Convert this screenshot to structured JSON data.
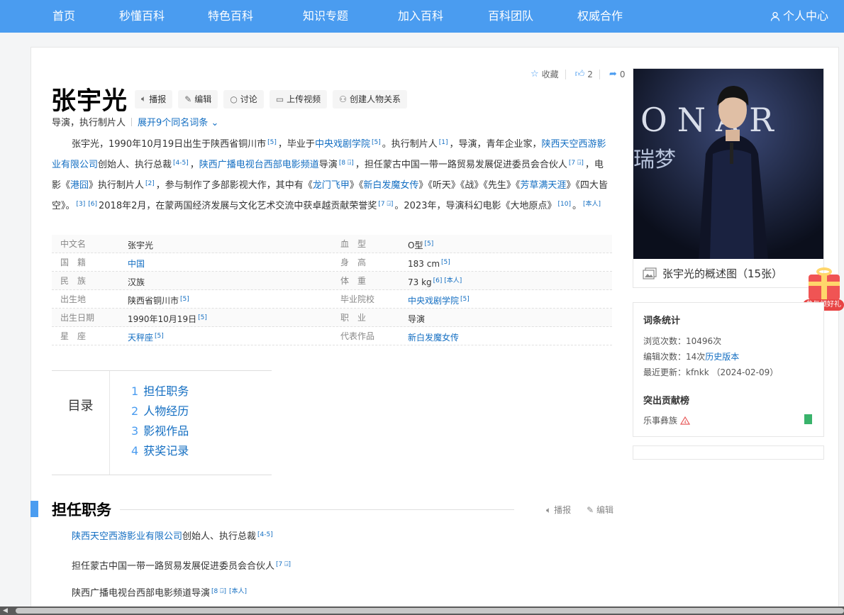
{
  "nav": {
    "items": [
      "首页",
      "秒懂百科",
      "特色百科",
      "知识专题",
      "加入百科",
      "百科团队",
      "权威合作"
    ],
    "user": "个人中心"
  },
  "entry": {
    "title": "张宇光",
    "tools": [
      "播报",
      "编辑",
      "讨论",
      "上传视频",
      "创建人物关系"
    ],
    "actions": {
      "collect": "收藏",
      "like_count": "2",
      "share_count": "0"
    },
    "desc": "导演，执行制片人",
    "expand": "展开9个同名词条"
  },
  "summary": {
    "p1": "张宇光，1990年10月19日出生于陕西省铜川市",
    "ref5": "[5]",
    "p2": "，毕业于",
    "school": "中央戏剧学院",
    "p3": "。执行制片人",
    "ref1": "[1]",
    "p4": "，导演，青年企业家，",
    "company": "陕西天空西游影业有限公司",
    "p5": "创始人、执行总裁",
    "ref45": "[4-5]",
    "p6": "，",
    "channel": "陕西广播电视台西部电影频道",
    "p7": "导演",
    "ref8": "[8 ⍈]",
    "p8": "，担任蒙古中国一带一路贸易发展促进委员会合伙人",
    "ref7": "[7 ⍈]",
    "p9": "，电影《",
    "film1": "港囧",
    "p10": "》执行制片人",
    "ref2": "[2]",
    "p11": "，参与制作了多部影视大作，其中有《",
    "film2": "龙门飞甲",
    "p12": "》《",
    "film3": "新白发魔女传",
    "p13": "》《听天》《战》《先生》《",
    "film4": "芳草满天涯",
    "p14": "》《四大皆空》。",
    "ref3": "[3]",
    "ref6": "[6]",
    "p15": "2018年2月，在蒙两国经济发展与文化艺术交流中获卓越贡献荣誉奖",
    "p16": "。2023年，导演科幻电影《大地原点》",
    "ref10": "[10]",
    "p17": "。",
    "self_tag": "[本人]"
  },
  "basic_info": [
    {
      "name": "中文名",
      "value": "张宇光",
      "ref": "",
      "link": false
    },
    {
      "name": "血　型",
      "value": "O型",
      "ref": "[5]",
      "link": false
    },
    {
      "name": "国　籍",
      "value": "中国",
      "ref": "",
      "link": true
    },
    {
      "name": "身　高",
      "value": "183 cm",
      "ref": "[5]",
      "link": false
    },
    {
      "name": "民　族",
      "value": "汉族",
      "ref": "",
      "link": false
    },
    {
      "name": "体　重",
      "value": "73 kg",
      "ref": "[6] [本人]",
      "link": false
    },
    {
      "name": "出生地",
      "value": "陕西省铜川市",
      "ref": "[5]",
      "link": false
    },
    {
      "name": "毕业院校",
      "value": "中央戏剧学院",
      "ref": "[5]",
      "link": true
    },
    {
      "name": "出生日期",
      "value": "1990年10月19日",
      "ref": "[5]",
      "link": false
    },
    {
      "name": "职　业",
      "value": "导演",
      "ref": "",
      "link": false
    },
    {
      "name": "星　座",
      "value": "天秤座",
      "ref": "[5]",
      "link": true
    },
    {
      "name": "代表作品",
      "value": "新白发魔女传",
      "ref": "",
      "link": true
    }
  ],
  "catalog": {
    "title": "目录",
    "items": [
      {
        "num": "1",
        "label": "担任职务"
      },
      {
        "num": "2",
        "label": "人物经历"
      },
      {
        "num": "3",
        "label": "影视作品"
      },
      {
        "num": "4",
        "label": "获奖记录"
      }
    ]
  },
  "section1": {
    "title": "担任职务",
    "speak": "播报",
    "edit": "编辑",
    "para1_link": "陕西天空西游影业有限公司",
    "para1_text": "创始人、执行总裁",
    "para1_ref": "[4-5]",
    "para2_text": "担任蒙古中国一带一路贸易发展促进委员会合伙人",
    "para2_ref": "[7 ⍈]",
    "para3_text": "陕西广播电视台西部电影频道导演",
    "para3_ref": "[8 ⍈]",
    "para3_tag": "[本人]"
  },
  "album": {
    "caption": "张宇光的概述图（15张）",
    "photo_text_top": "ONAR",
    "photo_text_side": "瑞梦"
  },
  "stats": {
    "title": "词条统计",
    "views": "浏览次数：10496次",
    "edits_prefix": "编辑次数：14次",
    "history": "历史版本",
    "updated": "最近更新：kfnkk （2024-02-09）",
    "contrib_title": "突出贡献榜",
    "contributor": "乐事彝族"
  },
  "gift": {
    "label": "参与领好礼"
  },
  "colors": {
    "brand": "#4a9cf0",
    "link": "#136ec2"
  }
}
